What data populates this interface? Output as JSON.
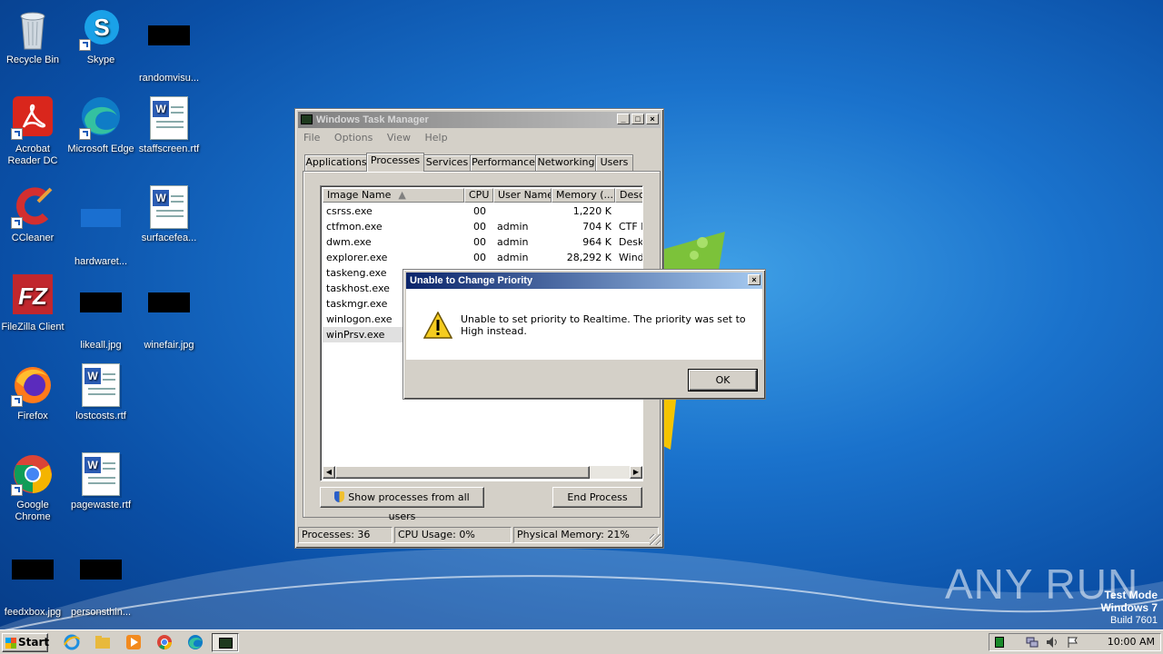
{
  "desktop": {
    "icons": [
      {
        "label": "Recycle Bin"
      },
      {
        "label": "Skype"
      },
      {
        "label": "randomvisu..."
      },
      {
        "label": "Acrobat Reader DC"
      },
      {
        "label": "Microsoft Edge"
      },
      {
        "label": "staffscreen.rtf"
      },
      {
        "label": "CCleaner"
      },
      {
        "label": "hardwaret..."
      },
      {
        "label": "surfacefea..."
      },
      {
        "label": "FileZilla Client"
      },
      {
        "label": "likeall.jpg"
      },
      {
        "label": "winefair.jpg"
      },
      {
        "label": "Firefox"
      },
      {
        "label": "lostcosts.rtf"
      },
      {
        "label": "Google Chrome"
      },
      {
        "label": "pagewaste.rtf"
      },
      {
        "label": "feedxbox.jpg"
      },
      {
        "label": "personsthin..."
      }
    ]
  },
  "taskmgr": {
    "title": "Windows Task Manager",
    "menu": [
      "File",
      "Options",
      "View",
      "Help"
    ],
    "tabs": [
      "Applications",
      "Processes",
      "Services",
      "Performance",
      "Networking",
      "Users"
    ],
    "selected_tab": "Processes",
    "columns": [
      "Image Name",
      "CPU",
      "User Name",
      "Memory (...",
      "Desc"
    ],
    "rows": [
      {
        "name": "csrss.exe",
        "cpu": "00",
        "user": "",
        "mem": "1,220 K",
        "desc": ""
      },
      {
        "name": "ctfmon.exe",
        "cpu": "00",
        "user": "admin",
        "mem": "704 K",
        "desc": "CTF L"
      },
      {
        "name": "dwm.exe",
        "cpu": "00",
        "user": "admin",
        "mem": "964 K",
        "desc": "Desk"
      },
      {
        "name": "explorer.exe",
        "cpu": "00",
        "user": "admin",
        "mem": "28,292 K",
        "desc": "Wind"
      },
      {
        "name": "taskeng.exe",
        "cpu": "",
        "user": "",
        "mem": "",
        "desc": ""
      },
      {
        "name": "taskhost.exe",
        "cpu": "",
        "user": "",
        "mem": "",
        "desc": ""
      },
      {
        "name": "taskmgr.exe",
        "cpu": "",
        "user": "",
        "mem": "",
        "desc": ""
      },
      {
        "name": "winlogon.exe",
        "cpu": "",
        "user": "",
        "mem": "",
        "desc": ""
      },
      {
        "name": "winPrsv.exe",
        "cpu": "",
        "user": "",
        "mem": "",
        "desc": ""
      }
    ],
    "show_all_label": "Show processes from all users",
    "end_process_label": "End Process",
    "status": {
      "processes": "Processes: 36",
      "cpu": "CPU Usage: 0%",
      "memory": "Physical Memory: 21%"
    }
  },
  "dialog": {
    "title": "Unable to Change Priority",
    "message": "Unable to set priority to Realtime.  The priority was set to High instead.",
    "ok_label": "OK"
  },
  "taskbar": {
    "start_label": "Start",
    "clock": "10:00 AM"
  },
  "watermark": {
    "line1": "Test Mode",
    "line2": "Windows 7",
    "line3": "Build 7601",
    "brand": "ANY RUN"
  }
}
